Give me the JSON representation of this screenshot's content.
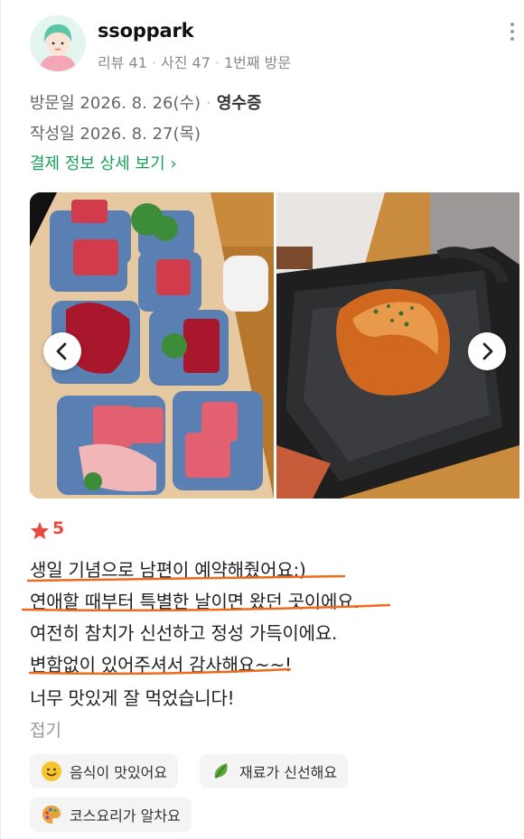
{
  "user": {
    "name": "ssoppark",
    "review_count": "리뷰 41",
    "photo_count": "사진 47",
    "visit_count": "1번째 방문"
  },
  "visit": {
    "visit_label": "방문일",
    "visit_date": "2026. 8. 26(수)",
    "receipt": "영수증",
    "written_label": "작성일",
    "written_date": "2026. 8. 27(목)"
  },
  "payment_link": "결제 정보 상세 보기 ›",
  "rating": "5",
  "review_lines": [
    "생일 기념으로 남편이 예약해줬어요:)",
    "연애할 때부터 특별한 날이면 왔던 곳이에요.",
    "여전히 참치가 신선하고 정성 가득이에요.",
    "변함없이 있어주셔서 감사해요~~!",
    "너무 맛있게 잘 먹었습니다!"
  ],
  "fold_label": "접기",
  "tags": [
    {
      "label": "음식이 맛있어요",
      "icon": "smile-emoji-icon"
    },
    {
      "label": "재료가 신선해요",
      "icon": "leaf-icon"
    },
    {
      "label": "코스요리가 알차요",
      "icon": "palette-icon"
    }
  ],
  "colors": {
    "accent_green": "#1aa05a",
    "star_red": "#e94a3f",
    "underline_orange": "#f06a1e"
  }
}
